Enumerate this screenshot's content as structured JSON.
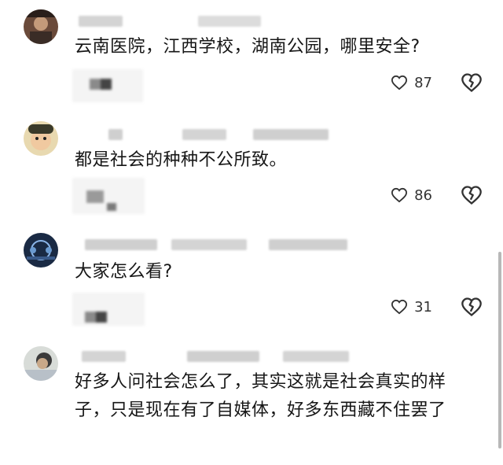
{
  "comments": [
    {
      "text": "云南医院，江西学校，湖南公园，哪里安全?",
      "likes": "87"
    },
    {
      "text": "都是社会的种种不公所致。",
      "likes": "86"
    },
    {
      "text": "大家怎么看?",
      "likes": "31"
    },
    {
      "text": "好多人问社会怎么了，其实这就是社会真实的样子，只是现在有了自媒体，好多东西藏不住罢了",
      "likes": ""
    }
  ],
  "icons": {
    "like": "heart-outline-icon",
    "dislike": "broken-heart-icon"
  },
  "colors": {
    "text": "#161616",
    "icon": "#333333",
    "blur": "#c8c8c8",
    "background": "#ffffff"
  }
}
